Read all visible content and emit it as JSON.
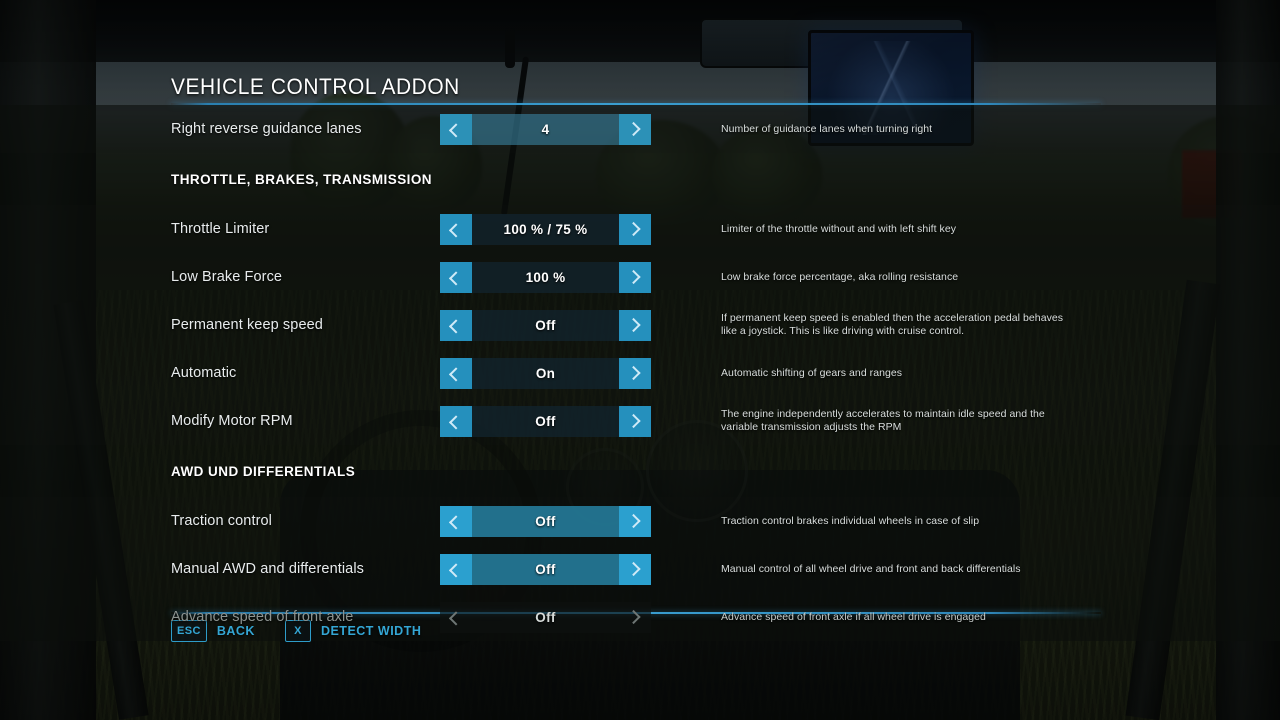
{
  "window": {
    "title": "VEHICLE CONTROL ADDON"
  },
  "colors": {
    "accent": "#2590bd",
    "accent_bright": "#2ba0cf",
    "rule": "#3a9ed0",
    "hotkey": "#34a6d4",
    "text": "#e8eced",
    "text_dim": "#8d9491"
  },
  "rows": [
    {
      "type": "setting",
      "name": "right-reverse-guidance-lanes",
      "label": "Right reverse guidance lanes",
      "value": "4",
      "description": "Number of guidance lanes when turning right",
      "state": "soft",
      "left_arrow": "chevron-left-icon",
      "right_arrow": "chevron-right-icon"
    },
    {
      "type": "section",
      "name": "section-throttle-brakes-transmission",
      "label": "THROTTLE, BRAKES, TRANSMISSION"
    },
    {
      "type": "setting",
      "name": "throttle-limiter",
      "label": "Throttle Limiter",
      "value": "100 % /  75 %",
      "description": "Limiter of the throttle without and with left shift key",
      "state": "normal",
      "left_arrow": "chevron-left-icon",
      "right_arrow": "chevron-right-icon"
    },
    {
      "type": "setting",
      "name": "low-brake-force",
      "label": "Low Brake Force",
      "value": "100 %",
      "description": "Low brake force percentage, aka rolling resistance",
      "state": "normal",
      "left_arrow": "chevron-left-icon",
      "right_arrow": "chevron-right-icon"
    },
    {
      "type": "setting",
      "name": "permanent-keep-speed",
      "label": "Permanent keep speed",
      "value": "Off",
      "description": "If permanent keep speed is enabled then the acceleration pedal behaves like a joystick. This is like driving with cruise control.",
      "state": "normal",
      "left_arrow": "chevron-left-icon",
      "right_arrow": "chevron-right-icon"
    },
    {
      "type": "setting",
      "name": "automatic",
      "label": "Automatic",
      "value": "On",
      "description": "Automatic shifting of gears and ranges",
      "state": "normal",
      "left_arrow": "chevron-left-icon",
      "right_arrow": "chevron-right-icon"
    },
    {
      "type": "setting",
      "name": "modify-motor-rpm",
      "label": "Modify Motor RPM",
      "value": "Off",
      "description": "The engine independently accelerates to maintain idle speed and the variable transmission adjusts the RPM",
      "state": "normal",
      "left_arrow": "chevron-left-icon",
      "right_arrow": "chevron-right-icon"
    },
    {
      "type": "section",
      "name": "section-awd-und-differentials",
      "label": "AWD UND DIFFERENTIALS"
    },
    {
      "type": "setting",
      "name": "traction-control",
      "label": "Traction control",
      "value": "Off",
      "description": "Traction control brakes individual wheels in case of slip",
      "state": "highlighted",
      "left_arrow": "chevron-left-icon",
      "right_arrow": "chevron-right-icon"
    },
    {
      "type": "setting",
      "name": "manual-awd-and-differentials",
      "label": "Manual AWD and differentials",
      "value": "Off",
      "description": "Manual control of all wheel drive and front and back differentials",
      "state": "highlighted",
      "left_arrow": "chevron-left-icon",
      "right_arrow": "chevron-right-icon"
    },
    {
      "type": "setting",
      "name": "advance-speed-of-front-axle",
      "label": "Advance speed of front axle",
      "value": "Off",
      "description": "Advance speed of front axle if all wheel drive is engaged",
      "state": "disabled",
      "left_arrow": "chevron-left-icon",
      "right_arrow": "chevron-right-icon"
    }
  ],
  "footer": {
    "hotkeys": [
      {
        "name": "back",
        "key": "ESC",
        "label": "BACK"
      },
      {
        "name": "detect-width",
        "key": "X",
        "label": "DETECT WIDTH"
      }
    ]
  }
}
